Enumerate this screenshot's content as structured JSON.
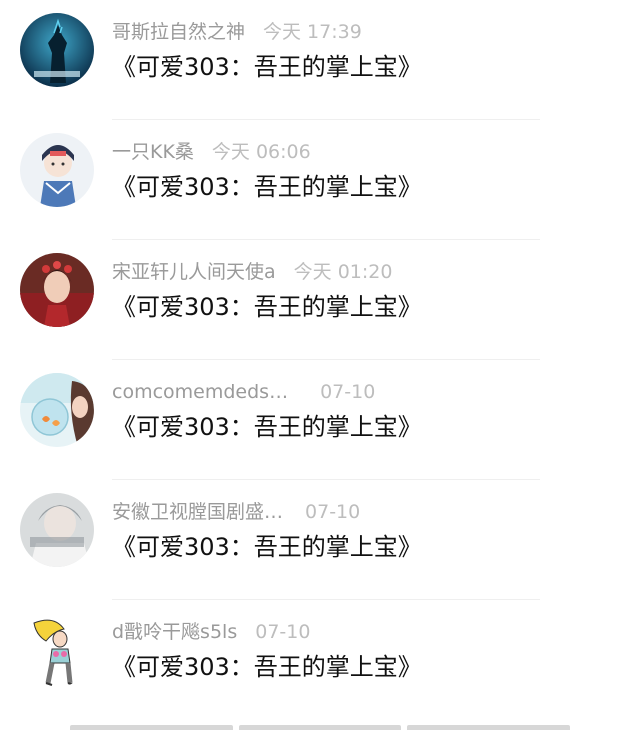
{
  "comments": [
    {
      "username": "哥斯拉自然之神",
      "time": "今天 17:39",
      "text": "《可爱303：吾王的掌上宝》",
      "avatar_icon": "godzilla-avatar"
    },
    {
      "username": "一只KK桑",
      "time": "今天 06:06",
      "text": "《可爱303：吾王的掌上宝》",
      "avatar_icon": "anime-character-avatar"
    },
    {
      "username": "宋亚轩儿人间天使a",
      "time": "今天 01:20",
      "text": "《可爱303：吾王的掌上宝》",
      "avatar_icon": "portrait-avatar"
    },
    {
      "username": "comcomemdeds…",
      "time": "07-10",
      "text": "《可爱303：吾王的掌上宝》",
      "avatar_icon": "fishbowl-girl-avatar"
    },
    {
      "username": "安徽卫视膛国剧盛…",
      "time": "07-10",
      "text": "《可爱303：吾王的掌上宝》",
      "avatar_icon": "faded-portrait-avatar"
    },
    {
      "username": "d戬呤干飚s5ls",
      "time": "07-10",
      "text": "《可爱303：吾王的掌上宝》",
      "avatar_icon": "cartoon-girl-avatar"
    }
  ]
}
